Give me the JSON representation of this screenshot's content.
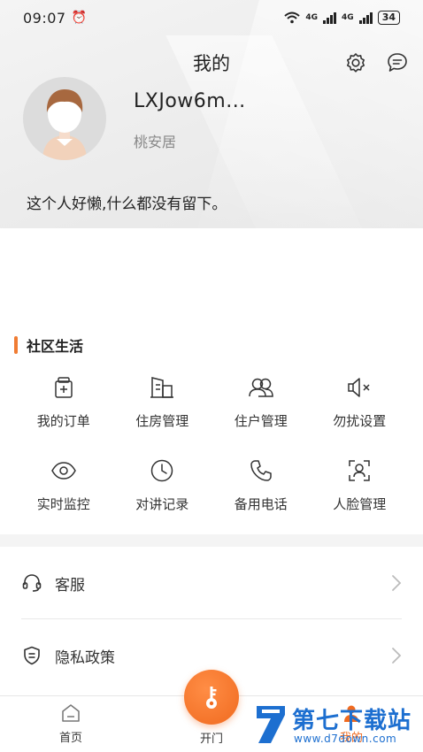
{
  "status_bar": {
    "time": "09:07",
    "network_1": "4G",
    "network_2": "4G",
    "battery": "34"
  },
  "header": {
    "title": "我的",
    "icons": [
      "settings-icon",
      "message-icon"
    ]
  },
  "profile": {
    "username": "LXJow6m...",
    "community": "桃安居",
    "bio": "这个人好懒,什么都没有留下。"
  },
  "community_life": {
    "title": "社区生活",
    "accent_color": "#f07c33",
    "items": [
      {
        "label": "我的订单",
        "icon": "order-icon"
      },
      {
        "label": "住房管理",
        "icon": "building-icon"
      },
      {
        "label": "住户管理",
        "icon": "residents-icon"
      },
      {
        "label": "勿扰设置",
        "icon": "mute-speaker-icon"
      },
      {
        "label": "实时监控",
        "icon": "eye-icon"
      },
      {
        "label": "对讲记录",
        "icon": "clock-icon"
      },
      {
        "label": "备用电话",
        "icon": "phone-icon"
      },
      {
        "label": "人脸管理",
        "icon": "face-scan-icon"
      }
    ]
  },
  "menu": [
    {
      "label": "客服",
      "icon": "headset-icon"
    },
    {
      "label": "隐私政策",
      "icon": "shield-icon"
    }
  ],
  "tabbar": {
    "home": "首页",
    "open_door": "开门",
    "mine": "我的",
    "accent_color": "#f06a1f"
  },
  "watermark": {
    "title": "第七下载站",
    "url": "www.d7down.com"
  }
}
